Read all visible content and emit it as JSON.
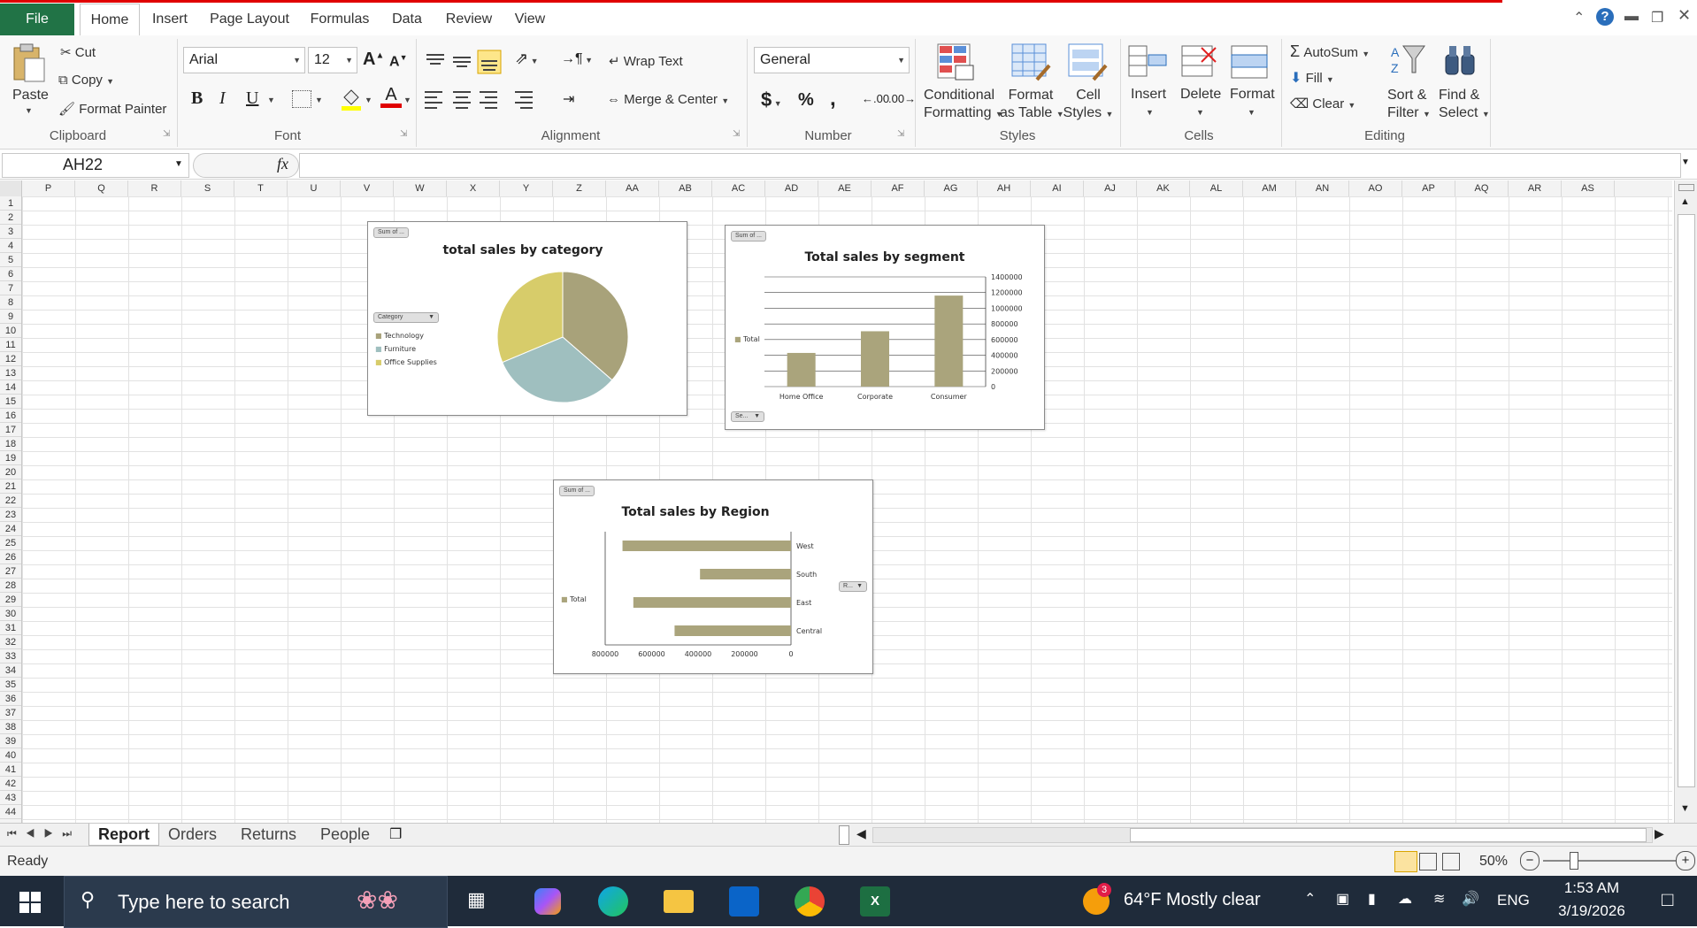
{
  "tabs": {
    "file": "File",
    "items": [
      "Home",
      "Insert",
      "Page Layout",
      "Formulas",
      "Data",
      "Review",
      "View"
    ],
    "active": "Home"
  },
  "clipboard": {
    "paste": "Paste",
    "cut": "Cut",
    "copy": "Copy",
    "format_painter": "Format Painter",
    "group_label": "Clipboard"
  },
  "font": {
    "name": "Arial",
    "size": "12",
    "bold": "B",
    "italic": "I",
    "underline": "U",
    "font_color_letter": "A",
    "group_label": "Font"
  },
  "alignment": {
    "wrap_text": "Wrap Text",
    "merge_center": "Merge & Center",
    "group_label": "Alignment"
  },
  "number": {
    "format": "General",
    "currency": "$",
    "percent": "%",
    "comma": ",",
    "inc_decimal": ".00",
    "dec_decimal": ".00",
    "group_label": "Number"
  },
  "styles": {
    "conditional_1": "Conditional",
    "conditional_2": "Formatting",
    "format_table_1": "Format",
    "format_table_2": "as Table",
    "cell_styles_1": "Cell",
    "cell_styles_2": "Styles",
    "group_label": "Styles"
  },
  "cells": {
    "insert": "Insert",
    "delete": "Delete",
    "format": "Format",
    "group_label": "Cells"
  },
  "editing": {
    "autosum": "AutoSum",
    "fill": "Fill",
    "clear": "Clear",
    "sort_1": "Sort &",
    "sort_2": "Filter",
    "find_1": "Find &",
    "find_2": "Select",
    "group_label": "Editing"
  },
  "formula_bar": {
    "name_box": "AH22",
    "fx": "fx",
    "value": ""
  },
  "columns": [
    "P",
    "Q",
    "R",
    "S",
    "T",
    "U",
    "V",
    "W",
    "X",
    "Y",
    "Z",
    "AA",
    "AB",
    "AC",
    "AD",
    "AE",
    "AF",
    "AG",
    "AH",
    "AI",
    "AJ",
    "AK",
    "AL",
    "AM",
    "AN",
    "AO",
    "AP",
    "AQ",
    "AR",
    "AS"
  ],
  "rows": [
    "1",
    "2",
    "3",
    "4",
    "5",
    "6",
    "7",
    "8",
    "9",
    "10",
    "11",
    "12",
    "13",
    "14",
    "15",
    "16",
    "17",
    "18",
    "19",
    "20",
    "21",
    "22",
    "23",
    "24",
    "25",
    "26",
    "27",
    "28",
    "29",
    "30",
    "31",
    "32",
    "33",
    "34",
    "35",
    "36",
    "37",
    "38",
    "39",
    "40",
    "41",
    "42",
    "43",
    "44"
  ],
  "chart_data": [
    {
      "type": "pie",
      "title": "total sales by category",
      "field_button": "Sum of ...",
      "legend_filter": "Category",
      "legend_position": "left",
      "categories": [
        "Technology",
        "Furniture",
        "Office Supplies"
      ],
      "values": [
        836154,
        741999,
        719047
      ],
      "colors": [
        "#a8a27a",
        "#9fbfbf",
        "#d7cc6a"
      ]
    },
    {
      "type": "bar",
      "title": "Total sales by segment",
      "field_button": "Sum of ...",
      "legend": [
        "Total"
      ],
      "axis_filter": "Se...",
      "categories": [
        "Home Office",
        "Corporate",
        "Consumer"
      ],
      "values": [
        429653,
        706146,
        1161401
      ],
      "ylim": [
        0,
        1400000
      ],
      "yticks": [
        "1400000",
        "1200000",
        "1000000",
        "800000",
        "600000",
        "400000",
        "200000",
        "0"
      ],
      "y_axis_side": "right",
      "color": "#aaa47c"
    },
    {
      "type": "bar",
      "orientation": "horizontal",
      "title": "Total sales by Region",
      "field_button": "Sum of ...",
      "legend": [
        "Total"
      ],
      "axis_filter": "R...",
      "categories": [
        "West",
        "South",
        "East",
        "Central"
      ],
      "values": [
        725458,
        391722,
        678781,
        501240
      ],
      "xlim": [
        0,
        800000
      ],
      "xticks": [
        "800000",
        "600000",
        "400000",
        "200000",
        "0"
      ],
      "reversed": true,
      "color": "#aaa47c"
    }
  ],
  "sheets": {
    "items": [
      "Report",
      "Orders",
      "Returns",
      "People"
    ],
    "active": "Report"
  },
  "status": {
    "ready": "Ready",
    "zoom": "50%"
  },
  "taskbar": {
    "search_placeholder": "Type here to search",
    "weather": "64°F  Mostly clear",
    "language": "ENG",
    "time": "1:53 AM",
    "date": "3/19/2026",
    "badge": "3"
  }
}
